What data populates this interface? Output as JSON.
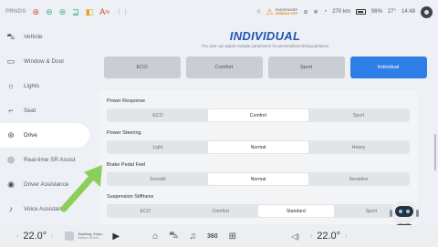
{
  "status": {
    "gear": "PRNDS",
    "airbag_label": "PASSENGER",
    "airbag_state": "AIRBAG OFF",
    "range": "270 km",
    "battery": "98%",
    "temperature": "27°",
    "time": "14:48"
  },
  "sidebar": {
    "items": [
      {
        "label": "Vehicle",
        "icon": "car-icon",
        "glyph": "⛍"
      },
      {
        "label": "Window & Door",
        "icon": "window-icon",
        "glyph": "▭"
      },
      {
        "label": "Lights",
        "icon": "lights-icon",
        "glyph": "☼"
      },
      {
        "label": "Seat",
        "icon": "seat-icon",
        "glyph": "⌐"
      },
      {
        "label": "Drive",
        "icon": "steering-wheel-icon",
        "glyph": "⊛"
      },
      {
        "label": "Real-time SR Assist",
        "icon": "sr-assist-icon",
        "glyph": "◎"
      },
      {
        "label": "Driver Assistance",
        "icon": "driver-assist-icon",
        "glyph": "◉"
      },
      {
        "label": "Voice Assistant",
        "icon": "voice-icon",
        "glyph": "♪"
      }
    ]
  },
  "main": {
    "title": "INDIVIDUAL",
    "subtitle": "The user can adjust multiple parameters for personalized driving pleasure",
    "modes": [
      "ECO",
      "Comfort",
      "Sport",
      "Individual"
    ],
    "sections": [
      {
        "title": "Power Response",
        "options": [
          "ECO",
          "Comfort",
          "Sport"
        ],
        "selected": 1
      },
      {
        "title": "Power Steering",
        "options": [
          "Light",
          "Normal",
          "Heavy"
        ],
        "selected": 1
      },
      {
        "title": "Brake Pedal Feel",
        "options": [
          "Smooth",
          "Normal",
          "Sensitive"
        ],
        "selected": 1
      },
      {
        "title": "Suspension Stiffness",
        "options": [
          "ECO",
          "Comfort",
          "Standard",
          "Sport"
        ],
        "selected": 2
      }
    ]
  },
  "bottom": {
    "left_temp": "22.0°",
    "right_temp": "22.0°",
    "song_title": "Anything, Anyw...",
    "song_artist": "Maren Morris",
    "dock_360": "360"
  },
  "colors": {
    "accent": "#2f7de6",
    "title": "#1f56b4",
    "arrow": "#8bcf5a"
  }
}
